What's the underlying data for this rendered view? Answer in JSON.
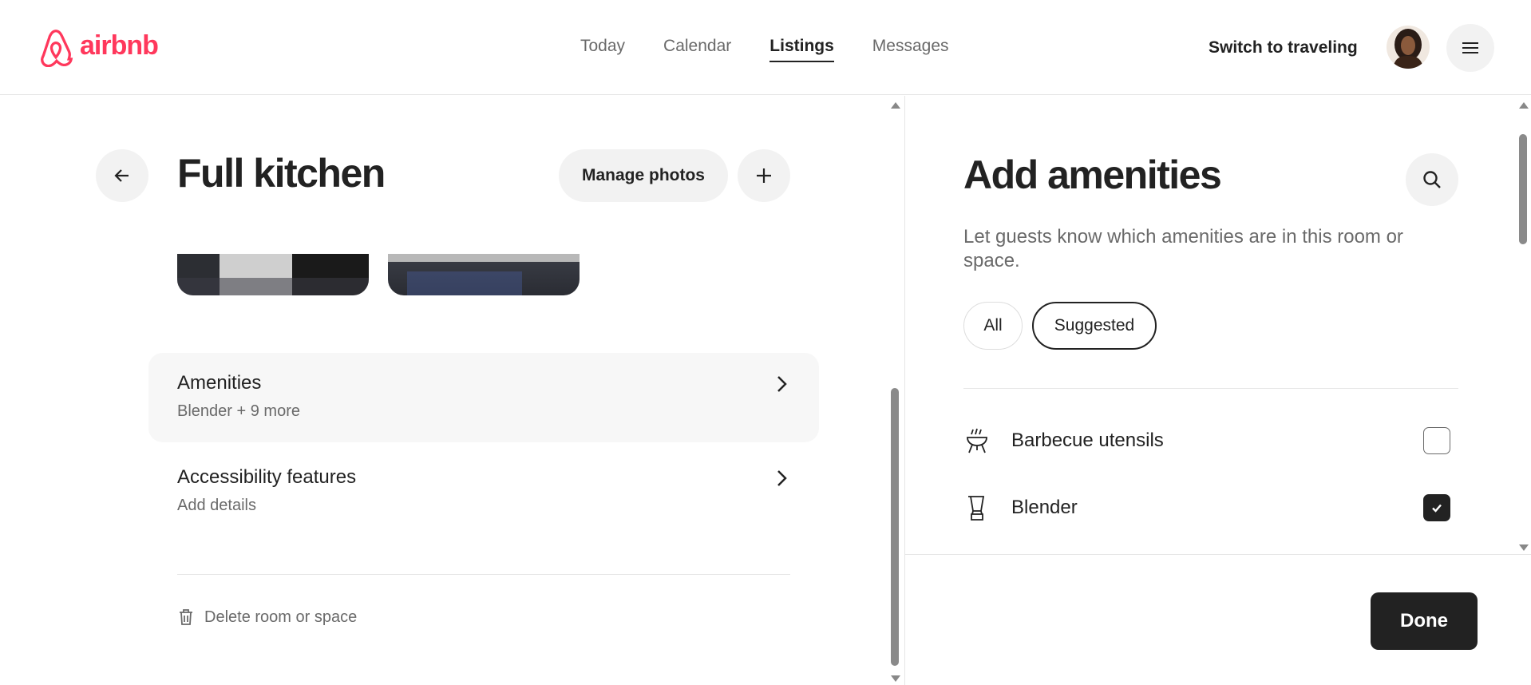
{
  "header": {
    "logo_text": "airbnb",
    "nav": [
      "Today",
      "Calendar",
      "Listings",
      "Messages"
    ],
    "active_nav": "Listings",
    "switch_label": "Switch to traveling"
  },
  "room": {
    "title": "Full kitchen",
    "manage_photos_label": "Manage photos",
    "rows": [
      {
        "title": "Amenities",
        "subtitle": "Blender + 9 more"
      },
      {
        "title": "Accessibility features",
        "subtitle": "Add details"
      }
    ],
    "delete_label": "Delete room or space"
  },
  "amenities_panel": {
    "title": "Add amenities",
    "subtitle": "Let guests know which amenities are in this room or space.",
    "filters": [
      "All",
      "Suggested"
    ],
    "active_filter": "Suggested",
    "items": [
      {
        "label": "Barbecue utensils",
        "icon": "barbecue-icon",
        "checked": false
      },
      {
        "label": "Blender",
        "icon": "blender-icon",
        "checked": true
      }
    ],
    "done_label": "Done"
  },
  "colors": {
    "brand": "#ff385c",
    "text": "#222222",
    "muted": "#6a6a6a"
  }
}
